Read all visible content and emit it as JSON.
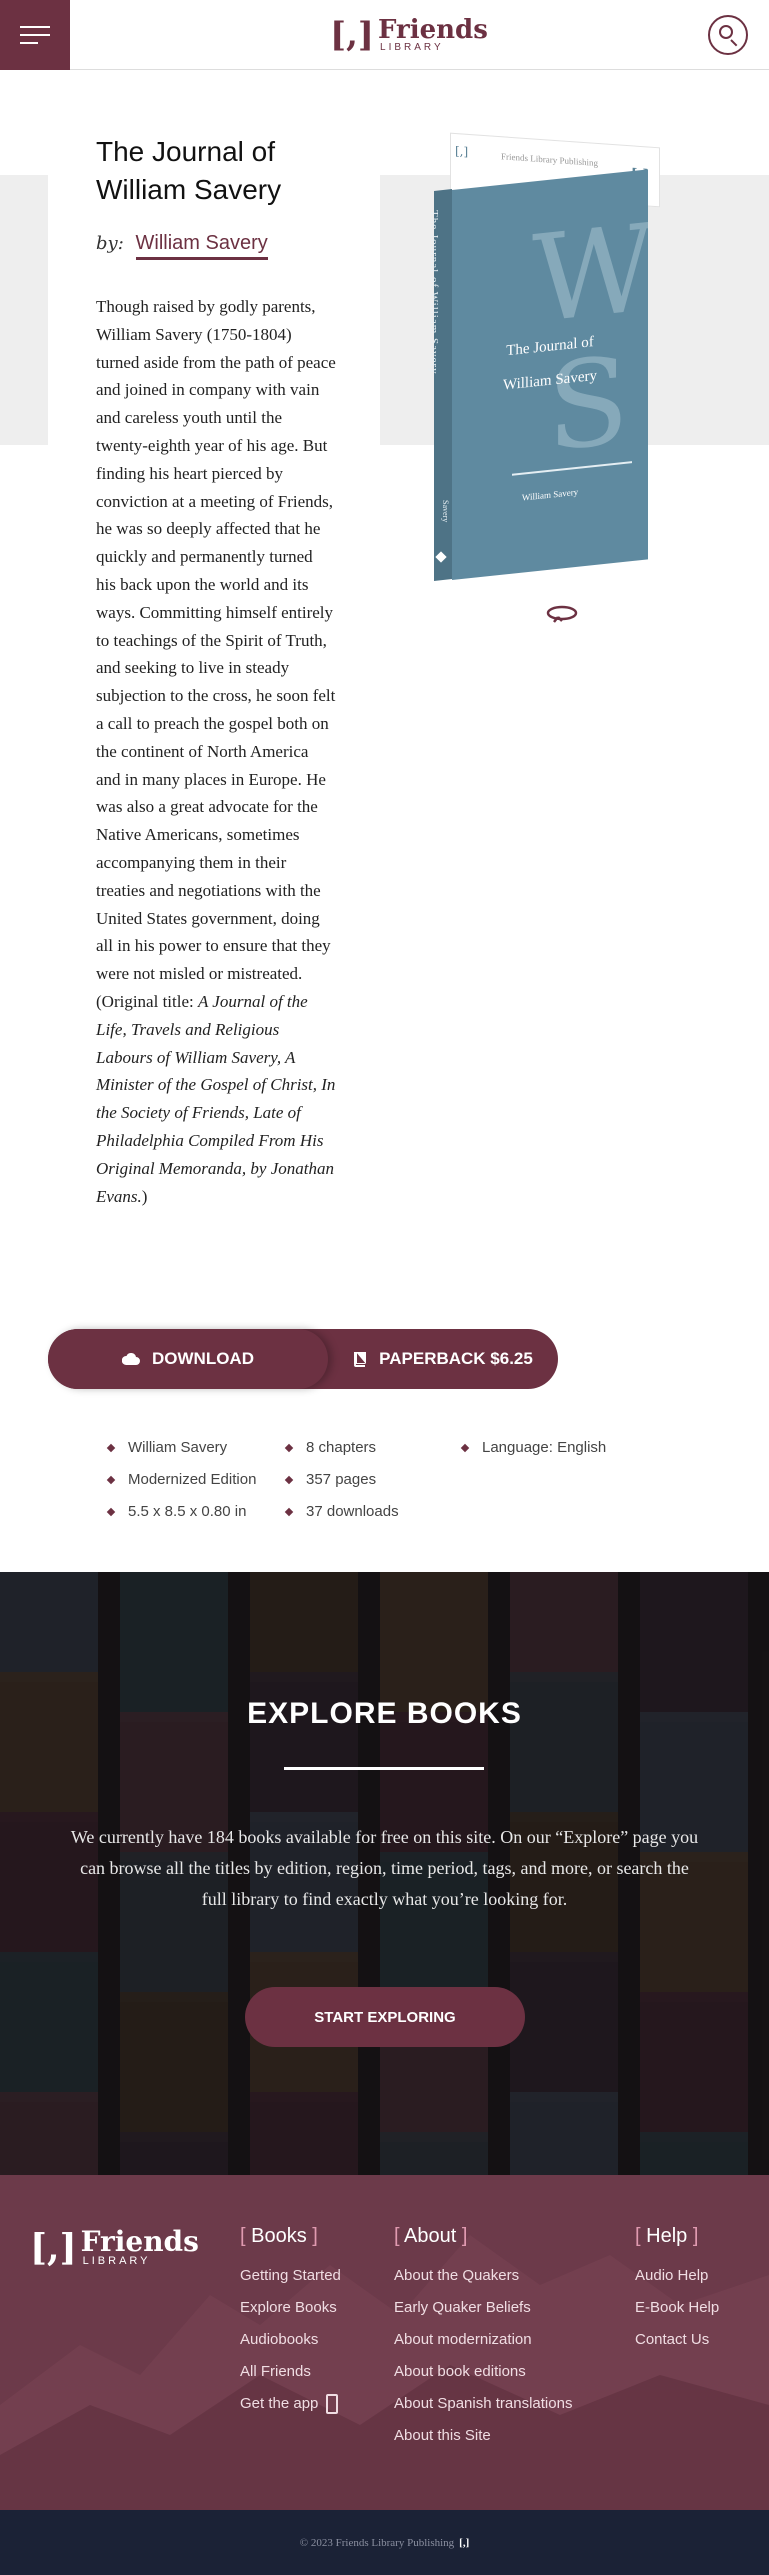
{
  "header": {
    "logo_bracket": "[,]",
    "logo_word": "Friends",
    "logo_sub": "LIBRARY"
  },
  "book": {
    "title": "The Journal of William Savery",
    "by_label": "by:",
    "author": "William Savery",
    "blurb_plain": "Though raised by godly parents, William Savery (1750-1804) turned aside from the path of peace and joined in company with vain and careless youth until the twenty-eighth year of his age. But finding his heart pierced by conviction at a meeting of Friends, he was so deeply affected that he quickly and permanently turned his back upon the world and its ways. Committing himself entirely to teachings of the Spirit of Truth, and seeking to live in steady subjection to the cross, he soon felt a call to preach the gospel both on the continent of North America and in many places in Europe. He was also a great advocate for the Native Americans, sometimes accompanying them in their treaties and negotiations with the United States government, doing all in his power to ensure that they were not misled or mistreated. (Original title: ",
    "blurb_italic": "A Journal of the Life, Travels and Religious Labours of William Savery, A Minister of the Gospel of Christ, In the Society of Friends, Late of Philadelphia Compiled From His Original Memoranda, by Jonathan Evans.",
    "blurb_end": ")",
    "cover": {
      "publisher": "Friends Library Publishing",
      "mini_logo": "[,]",
      "monogram_top": "W",
      "monogram_bottom": "S",
      "title_line1": "The Journal of",
      "title_line2": "William Savery",
      "author": "William Savery",
      "spine_title": "The Journal of William Savery",
      "spine_author": "Savery",
      "color": "#5f8aa0"
    }
  },
  "actions": {
    "download": "DOWNLOAD",
    "paperback": "PAPERBACK $6.25"
  },
  "meta": {
    "col1": [
      "William Savery",
      "Modernized Edition",
      "5.5 x 8.5 x 0.80 in"
    ],
    "col2": [
      "8 chapters",
      "357 pages",
      "37 downloads"
    ],
    "col3": [
      "Language: English"
    ]
  },
  "explore": {
    "heading": "EXPLORE BOOKS",
    "text": "We currently have 184 books available for free on this site. On our “Explore” page you can browse all the titles by edition, region, time period, tags, and more, or search the full library to find exactly what you’re looking for.",
    "cta": "START EXPLORING"
  },
  "footer": {
    "logo_bracket": "[,]",
    "logo_word": "Friends",
    "logo_sub": "LIBRARY",
    "books": {
      "heading": "Books",
      "links": [
        "Getting Started",
        "Explore Books",
        "Audiobooks",
        "All Friends",
        "Get the app"
      ]
    },
    "about": {
      "heading": "About",
      "links": [
        "About the Quakers",
        "Early Quaker Beliefs",
        "About modernization",
        "About book editions",
        "About Spanish translations",
        "About this Site"
      ]
    },
    "help": {
      "heading": "Help",
      "links": [
        "Audio Help",
        "E-Book Help",
        "Contact Us"
      ]
    },
    "copyright": "© 2023 Friends Library Publishing",
    "copyright_mark": "[,]"
  },
  "colors": {
    "brand": "#6c3142",
    "footer_bg": "#6c3a4a",
    "bottom_bar": "#1b2236"
  }
}
